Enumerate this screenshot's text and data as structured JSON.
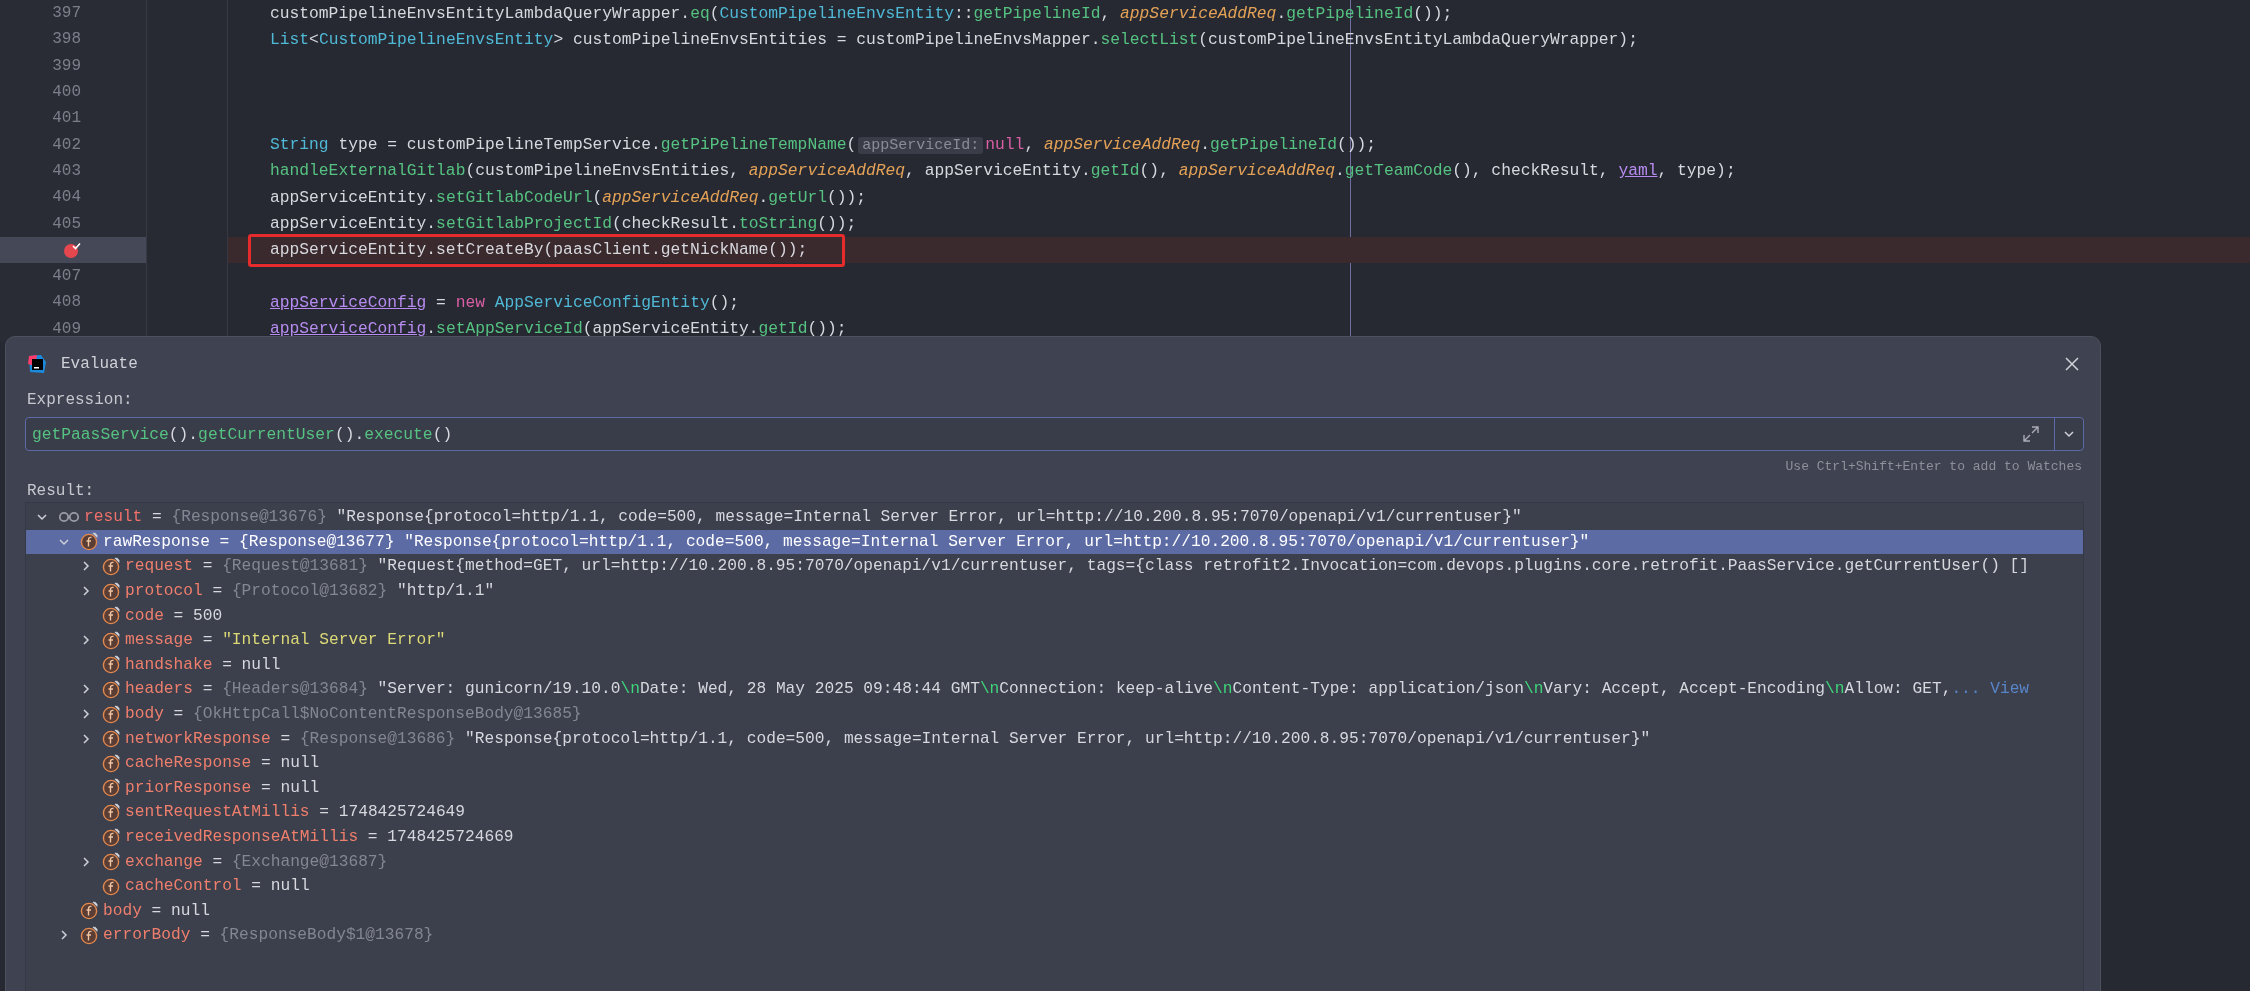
{
  "editor": {
    "lines": [
      {
        "number": "397",
        "breakpoint": false,
        "boxed": false,
        "segments": [
          {
            "text": "customPipelineEnvsEntityLambdaQueryWrapper.",
            "kind": "plain"
          },
          {
            "text": "eq",
            "kind": "method"
          },
          {
            "text": "(",
            "kind": "plain"
          },
          {
            "text": "CustomPipelineEnvsEntity",
            "kind": "type"
          },
          {
            "text": "::",
            "kind": "plain"
          },
          {
            "text": "getPipelineId",
            "kind": "method"
          },
          {
            "text": ", ",
            "kind": "plain"
          },
          {
            "text": "appServiceAddReq",
            "kind": "param"
          },
          {
            "text": ".",
            "kind": "plain"
          },
          {
            "text": "getPipelineId",
            "kind": "method"
          },
          {
            "text": "());",
            "kind": "plain"
          }
        ]
      },
      {
        "number": "398",
        "breakpoint": false,
        "boxed": false,
        "segments": [
          {
            "text": "List",
            "kind": "type"
          },
          {
            "text": "<",
            "kind": "plain"
          },
          {
            "text": "CustomPipelineEnvsEntity",
            "kind": "type"
          },
          {
            "text": "> customPipelineEnvsEntities = customPipelineEnvsMapper.",
            "kind": "plain"
          },
          {
            "text": "selectList",
            "kind": "method"
          },
          {
            "text": "(customPipelineEnvsEntityLambdaQueryWrapper);",
            "kind": "plain"
          }
        ]
      },
      {
        "number": "399",
        "breakpoint": false,
        "boxed": false
      },
      {
        "number": "400",
        "breakpoint": false,
        "boxed": false
      },
      {
        "number": "401",
        "breakpoint": false,
        "boxed": false
      },
      {
        "number": "402",
        "breakpoint": false,
        "boxed": false,
        "segments": [
          {
            "text": "String",
            "kind": "type"
          },
          {
            "text": " type = customPipelineTempService.",
            "kind": "plain"
          },
          {
            "text": "getPiPelineTempName",
            "kind": "method"
          },
          {
            "text": "(",
            "kind": "plain"
          },
          {
            "text": "appServiceId:",
            "kind": "hint"
          },
          {
            "text": "null",
            "kind": "keyword"
          },
          {
            "text": ", ",
            "kind": "plain"
          },
          {
            "text": "appServiceAddReq",
            "kind": "param"
          },
          {
            "text": ".",
            "kind": "plain"
          },
          {
            "text": "getPipelineId",
            "kind": "method"
          },
          {
            "text": "());",
            "kind": "plain"
          }
        ]
      },
      {
        "number": "403",
        "breakpoint": false,
        "boxed": false,
        "segments": [
          {
            "text": "handleExternalGitlab",
            "kind": "method"
          },
          {
            "text": "(customPipelineEnvsEntities, ",
            "kind": "plain"
          },
          {
            "text": "appServiceAddReq",
            "kind": "param"
          },
          {
            "text": ", appServiceEntity.",
            "kind": "plain"
          },
          {
            "text": "getId",
            "kind": "method"
          },
          {
            "text": "(), ",
            "kind": "plain"
          },
          {
            "text": "appServiceAddReq",
            "kind": "param"
          },
          {
            "text": ".",
            "kind": "plain"
          },
          {
            "text": "getTeamCode",
            "kind": "method"
          },
          {
            "text": "(), checkResult, ",
            "kind": "plain"
          },
          {
            "text": "yaml",
            "kind": "field"
          },
          {
            "text": ", type);",
            "kind": "plain"
          }
        ]
      },
      {
        "number": "404",
        "breakpoint": false,
        "boxed": false,
        "segments": [
          {
            "text": "appServiceEntity.",
            "kind": "plain"
          },
          {
            "text": "setGitlabCodeUrl",
            "kind": "method"
          },
          {
            "text": "(",
            "kind": "plain"
          },
          {
            "text": "appServiceAddReq",
            "kind": "param"
          },
          {
            "text": ".",
            "kind": "plain"
          },
          {
            "text": "getUrl",
            "kind": "method"
          },
          {
            "text": "());",
            "kind": "plain"
          }
        ]
      },
      {
        "number": "405",
        "breakpoint": false,
        "boxed": false,
        "segments": [
          {
            "text": "appServiceEntity.",
            "kind": "plain"
          },
          {
            "text": "setGitlabProjectId",
            "kind": "method"
          },
          {
            "text": "(checkResult.",
            "kind": "plain"
          },
          {
            "text": "toString",
            "kind": "method"
          },
          {
            "text": "());",
            "kind": "plain"
          }
        ]
      },
      {
        "breakpoint": true,
        "boxed": true,
        "segments": [
          {
            "text": "appServiceEntity.setCreateBy(paasClient.getNickName());",
            "kind": "plain"
          }
        ]
      },
      {
        "number": "407",
        "breakpoint": false,
        "boxed": false
      },
      {
        "number": "408",
        "breakpoint": false,
        "boxed": false,
        "segments": [
          {
            "text": "appServiceConfig",
            "kind": "field"
          },
          {
            "text": " = ",
            "kind": "plain"
          },
          {
            "text": "new",
            "kind": "keyword"
          },
          {
            "text": " AppServiceConfigEntity",
            "kind": "type"
          },
          {
            "text": "();",
            "kind": "plain"
          }
        ]
      },
      {
        "number": "409",
        "breakpoint": false,
        "boxed": false,
        "segments": [
          {
            "text": "appServiceConfig",
            "kind": "field"
          },
          {
            "text": ".",
            "kind": "plain"
          },
          {
            "text": "setAppServiceId",
            "kind": "method"
          },
          {
            "text": "(appServiceEntity.",
            "kind": "plain"
          },
          {
            "text": "getId",
            "kind": "method"
          },
          {
            "text": "());",
            "kind": "plain"
          }
        ]
      }
    ]
  },
  "evaluate": {
    "title": "Evaluate",
    "expression_label": "Expression:",
    "expression": [
      {
        "text": "getPaasService",
        "kind": "method"
      },
      {
        "text": "().",
        "kind": "plain"
      },
      {
        "text": "getCurrentUser",
        "kind": "method"
      },
      {
        "text": "().",
        "kind": "plain"
      },
      {
        "text": "execute",
        "kind": "method"
      },
      {
        "text": "()",
        "kind": "plain"
      }
    ],
    "hint": "Use Ctrl+Shift+Enter to add to Watches",
    "result_label": "Result:",
    "tree": [
      {
        "name": "result",
        "kind": "watch",
        "operator": "=",
        "expandable": true,
        "expanded": true,
        "selected": false,
        "type": "{Response@13676}",
        "value": [
          {
            "text": "\"Response{protocol=http/1.1, code=500, message=Internal Server Error, url=http://10.200.8.95:7070/openapi/v1/currentuser}\"",
            "kind": "plain"
          }
        ],
        "children": [
          {
            "name": "rawResponse",
            "kind": "field",
            "operator": "=",
            "expandable": true,
            "expanded": true,
            "selected": true,
            "type": "{Response@13677}",
            "value": [
              {
                "text": "\"Response{protocol=http/1.1, code=500, message=Internal Server Error, url=http://10.200.8.95:7070/openapi/v1/currentuser}\"",
                "kind": "plain"
              }
            ],
            "children": [
              {
                "name": "request",
                "kind": "field",
                "operator": "=",
                "expandable": true,
                "expanded": false,
                "selected": false,
                "type": "{Request@13681}",
                "value": [
                  {
                    "text": "\"Request{method=GET, url=http://10.200.8.95:7070/openapi/v1/currentuser, tags={class retrofit2.Invocation=com.devops.plugins.core.retrofit.PaasService.getCurrentUser() []",
                    "kind": "plain"
                  }
                ]
              },
              {
                "name": "protocol",
                "kind": "field",
                "operator": "=",
                "expandable": true,
                "expanded": false,
                "selected": false,
                "type": "{Protocol@13682}",
                "value": [
                  {
                    "text": "\"http/1.1\"",
                    "kind": "plain"
                  }
                ]
              },
              {
                "name": "code",
                "kind": "field",
                "operator": "=",
                "expandable": false,
                "selected": false,
                "value": [
                  {
                    "text": "500",
                    "kind": "plain"
                  }
                ]
              },
              {
                "name": "message",
                "kind": "field",
                "operator": "=",
                "expandable": true,
                "expanded": false,
                "selected": false,
                "value": [
                  {
                    "text": "\"Internal Server Error\"",
                    "kind": "string"
                  }
                ]
              },
              {
                "name": "handshake",
                "kind": "field",
                "operator": "=",
                "expandable": false,
                "selected": false,
                "value": [
                  {
                    "text": "null",
                    "kind": "plain"
                  }
                ]
              },
              {
                "name": "headers",
                "kind": "field",
                "operator": "=",
                "expandable": true,
                "expanded": false,
                "selected": false,
                "type": "{Headers@13684}",
                "value": [
                  {
                    "text": "\"Server: gunicorn/19.10.0",
                    "kind": "plain"
                  },
                  {
                    "text": "\\n",
                    "kind": "escape"
                  },
                  {
                    "text": "Date: Wed, 28 May 2025 09:48:44 GMT",
                    "kind": "plain"
                  },
                  {
                    "text": "\\n",
                    "kind": "escape"
                  },
                  {
                    "text": "Connection: keep-alive",
                    "kind": "plain"
                  },
                  {
                    "text": "\\n",
                    "kind": "escape"
                  },
                  {
                    "text": "Content-Type: application/json",
                    "kind": "plain"
                  },
                  {
                    "text": "\\n",
                    "kind": "escape"
                  },
                  {
                    "text": "Vary: Accept, Accept-Encoding",
                    "kind": "plain"
                  },
                  {
                    "text": "\\n",
                    "kind": "escape"
                  },
                  {
                    "text": "Allow: GET,",
                    "kind": "plain"
                  },
                  {
                    "text": "... View",
                    "kind": "link"
                  }
                ]
              },
              {
                "name": "body",
                "kind": "field",
                "operator": "=",
                "expandable": true,
                "expanded": false,
                "selected": false,
                "type": "{OkHttpCall$NoContentResponseBody@13685}"
              },
              {
                "name": "networkResponse",
                "kind": "field",
                "operator": "=",
                "expandable": true,
                "expanded": false,
                "selected": false,
                "type": "{Response@13686}",
                "value": [
                  {
                    "text": "\"Response{protocol=http/1.1, code=500, message=Internal Server Error, url=http://10.200.8.95:7070/openapi/v1/currentuser}\"",
                    "kind": "plain"
                  }
                ]
              },
              {
                "name": "cacheResponse",
                "kind": "field",
                "operator": "=",
                "expandable": false,
                "selected": false,
                "value": [
                  {
                    "text": "null",
                    "kind": "plain"
                  }
                ]
              },
              {
                "name": "priorResponse",
                "kind": "field",
                "operator": "=",
                "expandable": false,
                "selected": false,
                "value": [
                  {
                    "text": "null",
                    "kind": "plain"
                  }
                ]
              },
              {
                "name": "sentRequestAtMillis",
                "kind": "field",
                "operator": "=",
                "expandable": false,
                "selected": false,
                "value": [
                  {
                    "text": "1748425724649",
                    "kind": "plain"
                  }
                ]
              },
              {
                "name": "receivedResponseAtMillis",
                "kind": "field",
                "operator": "=",
                "expandable": false,
                "selected": false,
                "value": [
                  {
                    "text": "1748425724669",
                    "kind": "plain"
                  }
                ]
              },
              {
                "name": "exchange",
                "kind": "field",
                "operator": "=",
                "expandable": true,
                "expanded": false,
                "selected": false,
                "type": "{Exchange@13687}"
              },
              {
                "name": "cacheControl",
                "kind": "final",
                "operator": "=",
                "expandable": false,
                "selected": false,
                "value": [
                  {
                    "text": "null",
                    "kind": "plain"
                  }
                ]
              }
            ]
          },
          {
            "name": "body",
            "kind": "field",
            "operator": "=",
            "expandable": false,
            "selected": false,
            "value": [
              {
                "text": "null",
                "kind": "plain"
              }
            ]
          },
          {
            "name": "errorBody",
            "kind": "field",
            "operator": "=",
            "expandable": true,
            "expanded": false,
            "selected": false,
            "type": "{ResponseBody$1@13678}"
          }
        ]
      }
    ]
  }
}
